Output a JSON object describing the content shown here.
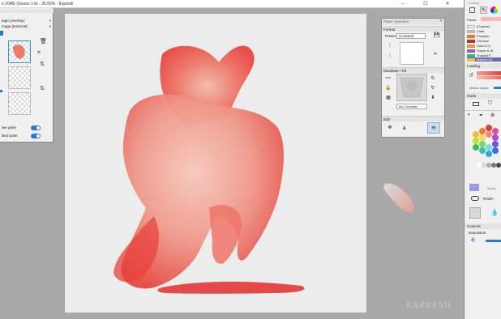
{
  "window": {
    "title": "e 2048) (Gesso 1.ilv - 36.93% - Expresii",
    "minimize": "–",
    "maximize": "☐",
    "close": "✕"
  },
  "layers_panel": {
    "rows": [
      "tage (Overlay)",
      "mage (External)"
    ],
    "options": [
      {
        "label": "iwe paint",
        "on": true
      },
      {
        "label": "itted paint",
        "on": true
      }
    ]
  },
  "paper_panel": {
    "title": "Paper Specifics",
    "format_label": "Format",
    "preset_label": "Preset",
    "preset_value": "(Custom)",
    "modulate_label": "Modulate / Tilt",
    "controller_value": "No Controller",
    "edit_label": "Edit"
  },
  "right_panel": {
    "loading_top": "Loading",
    "preset_label": "Preset",
    "presets": [
      {
        "name": "(Custom)",
        "color": "#eeeeee"
      },
      {
        "name": "Clear",
        "color": "#bbbbbb"
      },
      {
        "name": "Pumpkin",
        "color": "#e07a2a"
      },
      {
        "name": "Crimson",
        "color": "#c8283c"
      },
      {
        "name": "Gold & Cr",
        "color": "#d8a040"
      },
      {
        "name": "Purple & W",
        "color": "#9a5ab0"
      },
      {
        "name": "Tropical F",
        "color": "#30b0a0"
      },
      {
        "name": "Rubber Du",
        "color": "#e8c838"
      }
    ],
    "loading_label": "Loading",
    "master_alpha_label": "Master Alpha",
    "mode_label": "Mode",
    "alpha_label": "Alpha",
    "rgba_label": "RGBA",
    "controls_label": "Controls",
    "deposition_label": "Deposition"
  },
  "watermark": "EXPRESII",
  "colors": {
    "accent": "#2a78d0",
    "paint": "#e8403c",
    "canvas": "#ececec",
    "workspace": "#a9a9a9",
    "selected_preset": "#6a6aa8"
  }
}
